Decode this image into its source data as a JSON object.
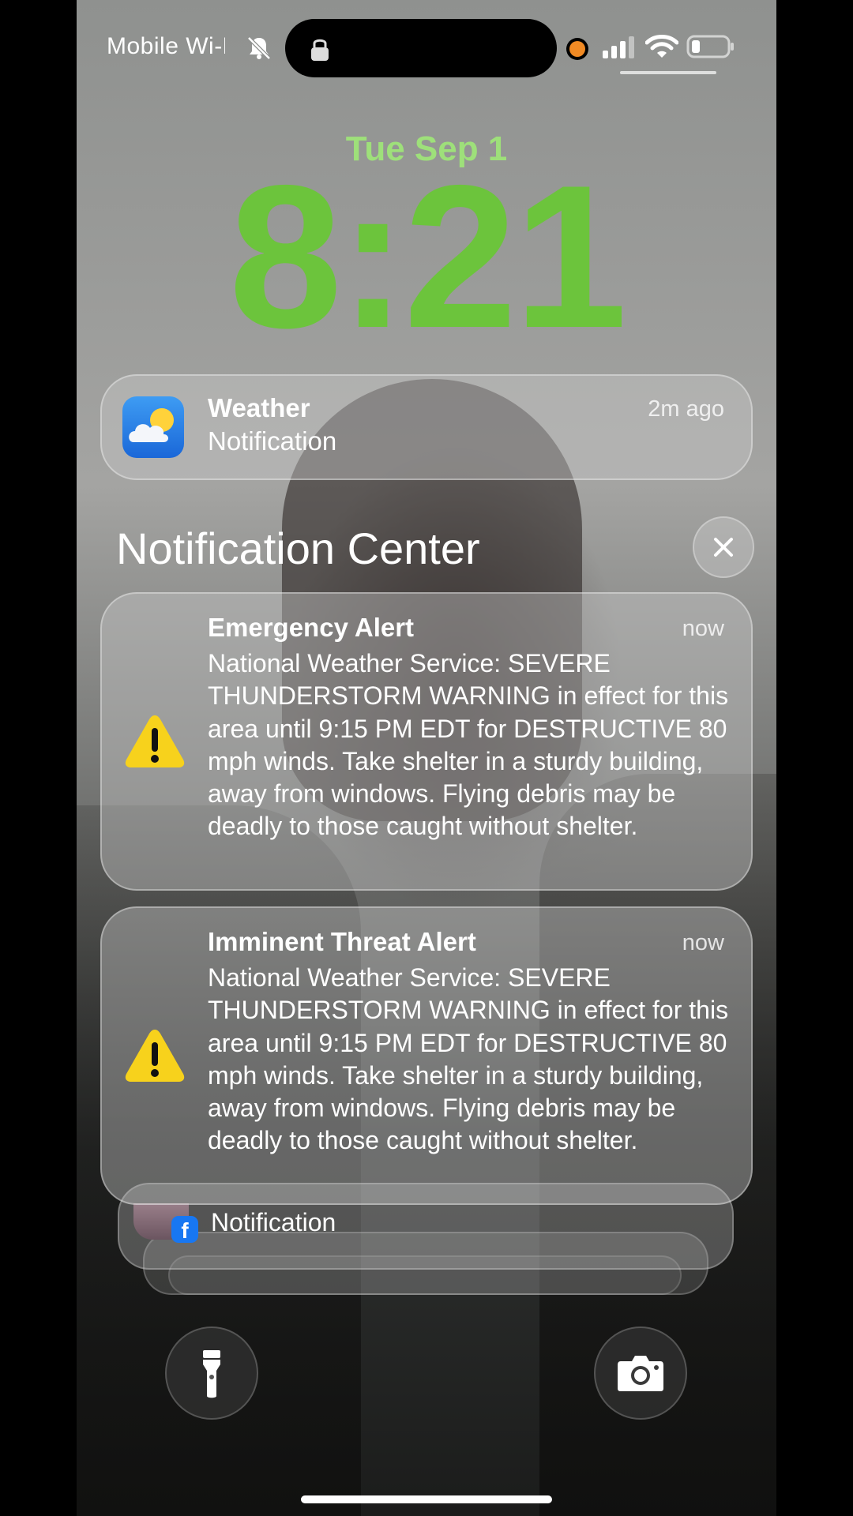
{
  "status_bar": {
    "carrier": "Mobile Wi-Fi",
    "icons": [
      "bell-slash-icon",
      "lock-icon",
      "recording-dot-icon",
      "signal-icon",
      "wifi-icon",
      "battery-icon"
    ],
    "accent_dot_color": "#f08a24"
  },
  "lock_screen": {
    "date": "Tue Sep 1",
    "time": "8:21",
    "clock_color": "#6cc43c",
    "date_color": "#9ee07a"
  },
  "weather_notification": {
    "app": "Weather",
    "subtitle": "Notification",
    "time": "2m ago",
    "icon": "weather-cloud-sun-icon"
  },
  "notification_center": {
    "title": "Notification Center",
    "close_icon": "close-icon"
  },
  "alerts": [
    {
      "title": "Emergency Alert",
      "time": "now",
      "icon": "warning-triangle-icon",
      "body": "National Weather Service: SEVERE THUNDERSTORM WARNING in effect for this area until 9:15 PM EDT for DESTRUCTIVE 80 mph winds. Take shelter in a sturdy building, away from windows. Flying debris may be deadly to those caught without shelter."
    },
    {
      "title": "Imminent Threat Alert",
      "time": "now",
      "icon": "warning-triangle-icon",
      "body": "National Weather Service: SEVERE THUNDERSTORM WARNING in effect for this area until 9:15 PM EDT for DESTRUCTIVE 80 mph winds. Take shelter in a sturdy building, away from windows. Flying debris may be deadly to those caught without shelter."
    }
  ],
  "stacked_notification": {
    "text": "Notification",
    "badge": "f",
    "icon": "facebook-icon"
  },
  "quick_actions": {
    "left": "flashlight-icon",
    "right": "camera-icon"
  }
}
